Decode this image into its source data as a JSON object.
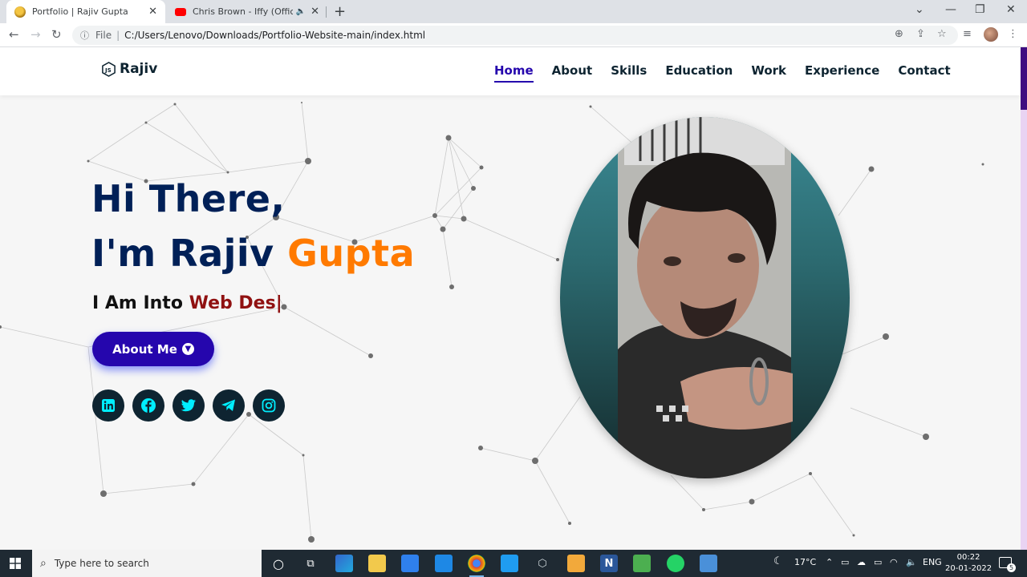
{
  "browser": {
    "tabs": [
      {
        "title": "Portfolio | Rajiv Gupta",
        "active": true
      },
      {
        "title": "Chris Brown - Iffy (Official Vi",
        "active": false,
        "audio": true
      }
    ],
    "address": {
      "scheme": "File",
      "url": "C:/Users/Lenovo/Downloads/Portfolio-Website-main/index.html"
    }
  },
  "site": {
    "logo_text": "Rajiv",
    "nav": [
      "Home",
      "About",
      "Skills",
      "Education",
      "Work",
      "Experience",
      "Contact"
    ],
    "active_nav": "Home",
    "hero": {
      "greeting": "Hi There,",
      "intro": "I'm Rajiv",
      "surname": "Gupta",
      "typing_prefix": "I Am Into",
      "typing_word": "Web Des|",
      "button_label": "About Me"
    },
    "socials": [
      "linkedin-icon",
      "facebook-icon",
      "twitter-icon",
      "telegram-icon",
      "instagram-icon"
    ],
    "colors": {
      "accent_blue": "#2506ad",
      "heading": "#002057",
      "orange": "#ff7a00",
      "typing_red": "#901111",
      "social_bg": "#0e2431",
      "social_icon": "#00eeff"
    }
  },
  "taskbar": {
    "search_placeholder": "Type here to search",
    "weather": "17°C",
    "language": "ENG",
    "time": "00:22",
    "date": "20-01-2022",
    "notifications": "5"
  }
}
